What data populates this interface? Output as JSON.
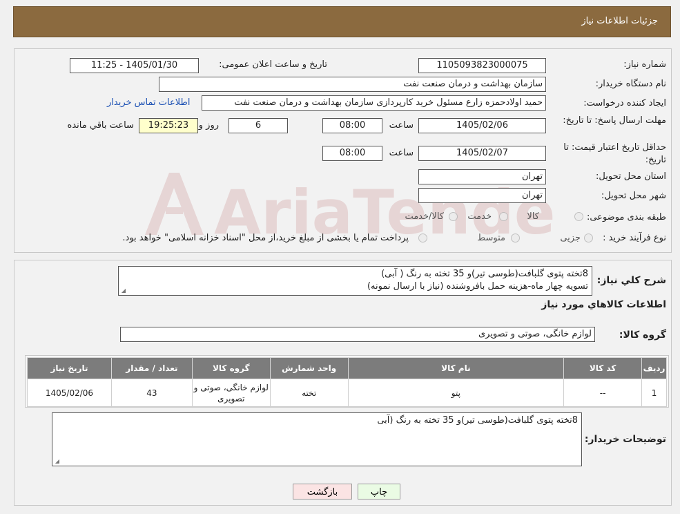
{
  "header": {
    "title": "جزئیات اطلاعات نیاز"
  },
  "fields": {
    "need_number_label": "شماره نیاز:",
    "need_number": "1105093823000075",
    "announce_label": "تاریخ و ساعت اعلان عمومی:",
    "announce_value": "1405/01/30 - 11:25",
    "buyer_org_label": "نام دستگاه خریدار:",
    "buyer_org": "سازمان بهداشت و درمان صنعت نفت",
    "creator_label": "ایجاد کننده درخواست:",
    "creator": "حمید اولادحمزه زارع مسئول خرید کارپردازی سازمان بهداشت و درمان صنعت نفت",
    "contact_link": "اطلاعات تماس خریدار",
    "deadline_label": "مهلت ارسال پاسخ: تا تاریخ:",
    "deadline_date": "1405/02/06",
    "time_label": "ساعت",
    "deadline_time": "08:00",
    "days_value": "6",
    "days_label": "روز و",
    "remaining_time": "19:25:23",
    "remaining_label": "ساعت باقي مانده",
    "price_validity_label": "حداقل تاریخ اعتبار قیمت: تا تاریخ:",
    "price_validity_date": "1405/02/07",
    "price_validity_time": "08:00",
    "province_label": "استان محل تحویل:",
    "province": "تهران",
    "city_label": "شهر محل تحویل:",
    "city": "تهران",
    "category_label": "طبقه بندی موضوعی:",
    "category_options": [
      "کالا",
      "خدمت",
      "کالا/خدمت"
    ],
    "purchase_type_label": "نوع فرآیند خرید :",
    "purchase_options": [
      "جزیی",
      "متوسط"
    ],
    "purchase_note": "پرداخت تمام یا بخشی از مبلغ خرید،از محل \"اسناد خزانه اسلامی\" خواهد بود."
  },
  "description": {
    "label": "شرح کلي نياز:",
    "line1": "8تخته پتوی گلبافت(طوسی تیر)و 35 تخته به رنگ ( آبی)",
    "line2": "تسویه چهار ماه-هزینه حمل بافروشنده (نیاز با ارسال نمونه)"
  },
  "goods_section_title": "اطلاعات کالاهاي مورد نياز",
  "goods_group": {
    "label": "گروه کالا:",
    "value": "لوازم خانگی، صوتی و تصویری"
  },
  "table": {
    "headers": [
      "رديف",
      "کد کالا",
      "نام کالا",
      "واحد شمارش",
      "گروه کالا",
      "تعداد / مقدار",
      "تاریخ نیاز"
    ],
    "rows": [
      [
        "1",
        "--",
        "پتو",
        "تخته",
        "لوازم خانگی، صوتی و تصویری",
        "43",
        "1405/02/06"
      ]
    ]
  },
  "buyer_notes": {
    "label": "توضیحات خریدار:",
    "text": "8تخته پتوی گلبافت(طوسی تیر)و 35 تخته به رنگ (آبی"
  },
  "buttons": {
    "print": "چاپ",
    "back": "بازگشت"
  },
  "watermark": {
    "text": "AriaTender.neT"
  },
  "colors": {
    "header_bg": "#8b6a3f",
    "table_header_bg": "#7c7c7c",
    "link": "#1a4fb3",
    "print_btn": "#eafbe4",
    "back_btn": "#fbe4e4"
  }
}
